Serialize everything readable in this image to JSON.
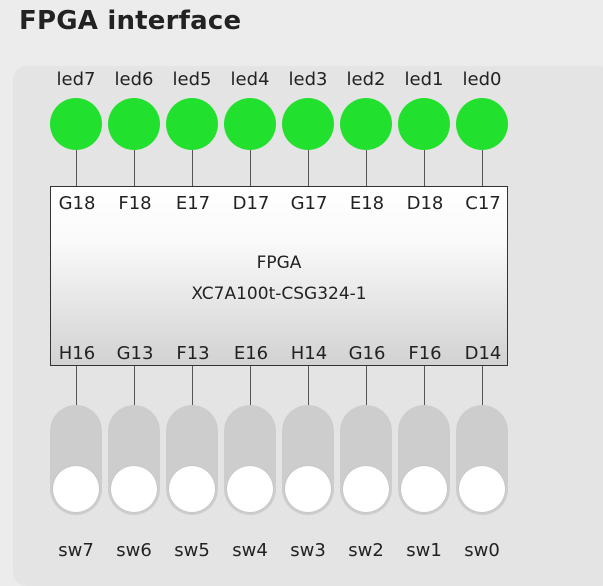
{
  "title": "FPGA interface",
  "colors": {
    "led_on": "#22e02e",
    "switch_track": "#cdcdcd",
    "switch_knob": "#ffffff"
  },
  "leds": [
    {
      "label": "led7",
      "pin": "G18",
      "on": true
    },
    {
      "label": "led6",
      "pin": "F18",
      "on": true
    },
    {
      "label": "led5",
      "pin": "E17",
      "on": true
    },
    {
      "label": "led4",
      "pin": "D17",
      "on": true
    },
    {
      "label": "led3",
      "pin": "G17",
      "on": true
    },
    {
      "label": "led2",
      "pin": "E18",
      "on": true
    },
    {
      "label": "led1",
      "pin": "D18",
      "on": true
    },
    {
      "label": "led0",
      "pin": "C17",
      "on": true
    }
  ],
  "fpga": {
    "name": "FPGA",
    "part": "XC7A100t-CSG324-1"
  },
  "switches": [
    {
      "label": "sw7",
      "pin": "H16",
      "on": false
    },
    {
      "label": "sw6",
      "pin": "G13",
      "on": false
    },
    {
      "label": "sw5",
      "pin": "F13",
      "on": false
    },
    {
      "label": "sw4",
      "pin": "E16",
      "on": false
    },
    {
      "label": "sw3",
      "pin": "H14",
      "on": false
    },
    {
      "label": "sw2",
      "pin": "G16",
      "on": false
    },
    {
      "label": "sw1",
      "pin": "F16",
      "on": false
    },
    {
      "label": "sw0",
      "pin": "D14",
      "on": false
    }
  ]
}
